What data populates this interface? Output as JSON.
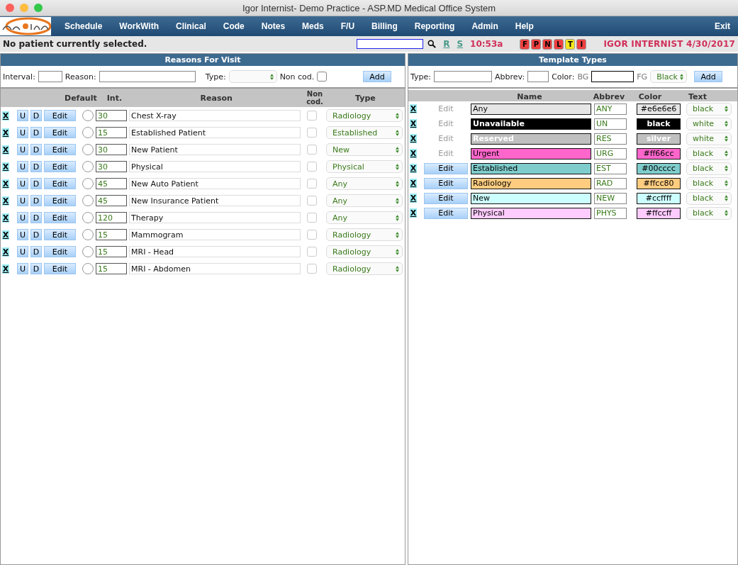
{
  "window": {
    "title": "Igor Internist- Demo Practice - ASP.MD Medical Office System"
  },
  "menu": [
    "Schedule",
    "WorkWith",
    "Clinical",
    "Code",
    "Notes",
    "Meds",
    "F/U",
    "Billing",
    "Reporting",
    "Admin",
    "Help"
  ],
  "exit": "Exit",
  "status": {
    "message": "No patient currently selected.",
    "links": [
      "R",
      "S"
    ],
    "time": "10:53a",
    "badges": [
      {
        "label": "F",
        "color": "#f04040"
      },
      {
        "label": "P",
        "color": "#f04040"
      },
      {
        "label": "N",
        "color": "#f04040"
      },
      {
        "label": "L",
        "color": "#f04040"
      },
      {
        "label": "T",
        "color": "#f5e51c"
      },
      {
        "label": "I",
        "color": "#f04040"
      }
    ],
    "user": "IGOR INTERNIST 4/30/2017"
  },
  "reasons": {
    "title": "Reasons For Visit",
    "form": {
      "interval_label": "Interval:",
      "reason_label": "Reason:",
      "type_label": "Type:",
      "noncod_label": "Non cod.",
      "noncod_checked": false,
      "add": "Add"
    },
    "columns": [
      "Default",
      "Int.",
      "Reason",
      "Non cod.",
      "Type"
    ],
    "rows": [
      {
        "delete": "X",
        "up": "U",
        "down": "D",
        "edit": "Edit",
        "interval": "30",
        "reason": "Chest X-ray",
        "default": false,
        "noncod": false,
        "type": "Radiology"
      },
      {
        "delete": "X",
        "up": "U",
        "down": "D",
        "edit": "Edit",
        "interval": "15",
        "reason": "Established Patient",
        "default": false,
        "noncod": false,
        "type": "Established"
      },
      {
        "delete": "X",
        "up": "U",
        "down": "D",
        "edit": "Edit",
        "interval": "30",
        "reason": "New Patient",
        "default": false,
        "noncod": false,
        "type": "New"
      },
      {
        "delete": "X",
        "up": "U",
        "down": "D",
        "edit": "Edit",
        "interval": "30",
        "reason": "Physical",
        "default": false,
        "noncod": false,
        "type": "Physical"
      },
      {
        "delete": "X",
        "up": "U",
        "down": "D",
        "edit": "Edit",
        "interval": "45",
        "reason": "New Auto Patient",
        "default": false,
        "noncod": false,
        "type": "Any"
      },
      {
        "delete": "X",
        "up": "U",
        "down": "D",
        "edit": "Edit",
        "interval": "45",
        "reason": "New Insurance Patient",
        "default": false,
        "noncod": false,
        "type": "Any"
      },
      {
        "delete": "X",
        "up": "U",
        "down": "D",
        "edit": "Edit",
        "interval": "120",
        "reason": "Therapy",
        "default": false,
        "noncod": false,
        "type": "Any"
      },
      {
        "delete": "X",
        "up": "U",
        "down": "D",
        "edit": "Edit",
        "interval": "15",
        "reason": "Mammogram",
        "default": false,
        "noncod": false,
        "type": "Radiology"
      },
      {
        "delete": "X",
        "up": "U",
        "down": "D",
        "edit": "Edit",
        "interval": "15",
        "reason": "MRI - Head",
        "default": false,
        "noncod": false,
        "type": "Radiology"
      },
      {
        "delete": "X",
        "up": "U",
        "down": "D",
        "edit": "Edit",
        "interval": "15",
        "reason": "MRI - Abdomen",
        "default": false,
        "noncod": false,
        "type": "Radiology"
      }
    ]
  },
  "templates": {
    "title": "Template Types",
    "form": {
      "type_label": "Type:",
      "abbrev_label": "Abbrev:",
      "color_label": "Color:",
      "bg_label": "BG",
      "fg_label": "FG",
      "fg_value": "Black",
      "add": "Add"
    },
    "columns": [
      "Name",
      "Abbrev",
      "Color",
      "Text"
    ],
    "rows": [
      {
        "delete": "X",
        "edit": "Edit",
        "name": "Any",
        "abbrev": "ANY",
        "color_text": "#e6e6e6",
        "color": "#e6e6e6",
        "text": "black",
        "editable": false
      },
      {
        "delete": "X",
        "edit": "Edit",
        "name": "Unavailable",
        "abbrev": "UN",
        "color_text": "black",
        "color": "#000000",
        "text": "white",
        "editable": false
      },
      {
        "delete": "X",
        "edit": "Edit",
        "name": "Reserved",
        "abbrev": "RES",
        "color_text": "silver",
        "color": "#c0c0c0",
        "text": "white",
        "editable": false
      },
      {
        "delete": "X",
        "edit": "Edit",
        "name": "Urgent",
        "abbrev": "URG",
        "color_text": "#ff66cc",
        "color": "#ff66cc",
        "text": "black",
        "editable": false
      },
      {
        "delete": "X",
        "edit": "Edit",
        "name": "Established",
        "abbrev": "EST",
        "color_text": "#00cccc",
        "color": "#7fcccc",
        "text": "black",
        "editable": true
      },
      {
        "delete": "X",
        "edit": "Edit",
        "name": "Radiology",
        "abbrev": "RAD",
        "color_text": "#ffcc80",
        "color": "#ffcc80",
        "text": "black",
        "editable": true
      },
      {
        "delete": "X",
        "edit": "Edit",
        "name": "New",
        "abbrev": "NEW",
        "color_text": "#ccffff",
        "color": "#ccffff",
        "text": "black",
        "editable": true
      },
      {
        "delete": "X",
        "edit": "Edit",
        "name": "Physical",
        "abbrev": "PHYS",
        "color_text": "#ffccff",
        "color": "#ffccff",
        "text": "black",
        "editable": true
      }
    ]
  }
}
